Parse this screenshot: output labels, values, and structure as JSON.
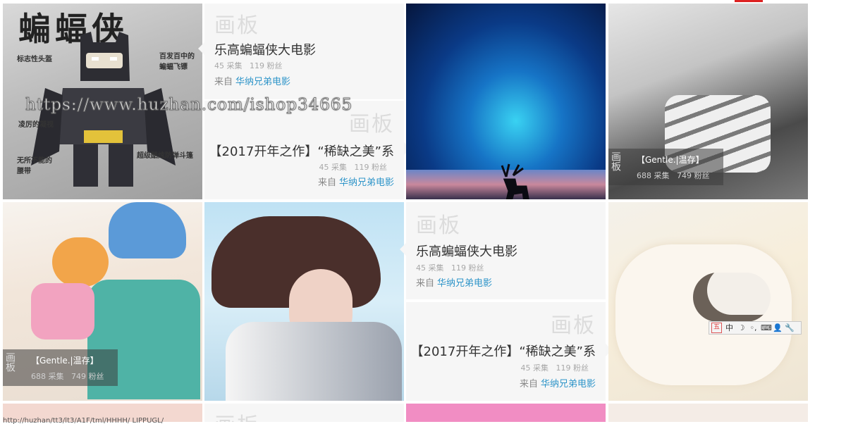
{
  "watermark": "https://www.huzhan.com/ishop34665",
  "board_word": "画板",
  "cards": [
    {
      "title": "乐高蝙蝠侠大电影",
      "collects": "45 采集",
      "fans": "119 粉丝",
      "from_label": "来自",
      "from_link": "华纳兄弟电影"
    },
    {
      "title": "【2017开年之作】“稀缺之美”系",
      "collects": "45 采集",
      "fans": "119 粉丝",
      "from_label": "来自",
      "from_link": "华纳兄弟电影"
    },
    {
      "title": "乐高蝙蝠侠大电影",
      "collects": "45 采集",
      "fans": "119 粉丝",
      "from_label": "来自",
      "from_link": "华纳兄弟电影"
    },
    {
      "title": "【2017开年之作】“稀缺之美”系",
      "collects": "45 采集",
      "fans": "119 粉丝",
      "from_label": "来自",
      "from_link": "华纳兄弟电影"
    }
  ],
  "overlays": [
    {
      "board": "画板",
      "title": "【Gentle.|温存】",
      "collects": "688 采集",
      "fans": "749 粉丝"
    },
    {
      "board": "画板",
      "title": "【Gentle.|温存】",
      "collects": "688 采集",
      "fans": "749 粉丝"
    }
  ],
  "batman": {
    "big_title": "蝙蝠侠",
    "labels": [
      "标志性头盔",
      "百发百中的蝙蝠飞镖",
      "凌厉的凝视",
      "无所不能的腰带",
      "超级酷炫防弹斗篷"
    ]
  },
  "ime": {
    "logo": "五",
    "items": [
      "中",
      "☽",
      "◦,",
      "⌨",
      "👤",
      "🔧"
    ]
  },
  "status_tip": "http://huzhan/tt3/lt3/A1F/tml/HHHH/ LIPPUGL/ "
}
